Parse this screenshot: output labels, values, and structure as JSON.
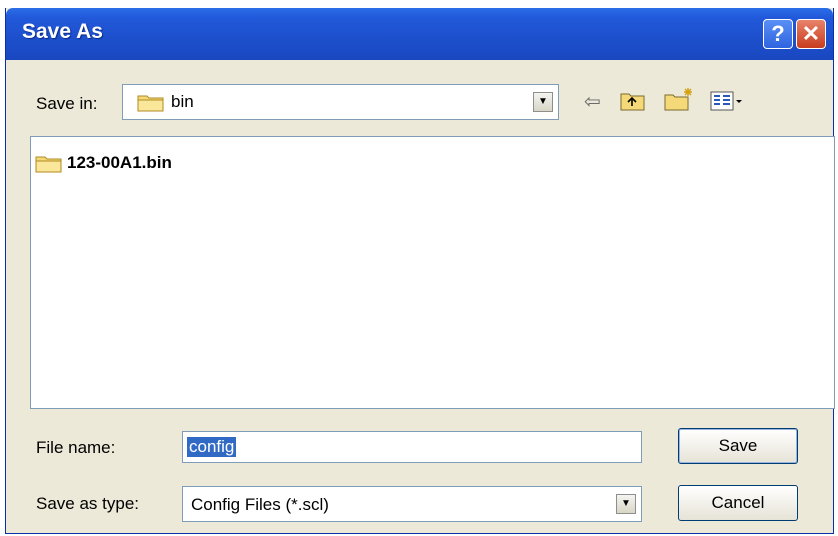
{
  "window": {
    "title": "Save As",
    "help_symbol": "?",
    "close_symbol": "✕"
  },
  "toolbar": {
    "save_in_label": "Save in:",
    "save_in_value": "bin",
    "icons": [
      "back-arrow-icon",
      "up-folder-icon",
      "new-folder-icon",
      "view-menu-icon"
    ]
  },
  "file_list": {
    "items": [
      {
        "name": "123-00A1.bin",
        "icon": "folder-icon"
      }
    ]
  },
  "form": {
    "file_name_label": "File name:",
    "file_name_value": "config",
    "save_as_type_label": "Save as type:",
    "save_as_type_value": "Config Files (*.scl)"
  },
  "buttons": {
    "save": "Save",
    "cancel": "Cancel"
  },
  "colors": {
    "titlebar": "#1d4fcc",
    "dialog_bg": "#ece9d8",
    "selection": "#316ac5"
  }
}
